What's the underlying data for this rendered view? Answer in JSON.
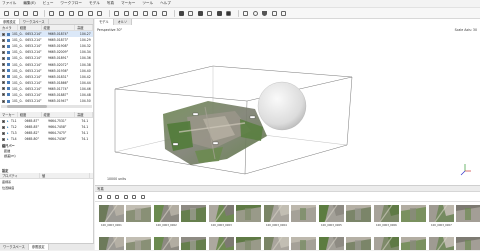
{
  "menu": [
    "ファイル",
    "編集(E)",
    "ビュー",
    "ワークフロー",
    "モデル",
    "写真",
    "マーカー",
    "ツール",
    "ヘルプ"
  ],
  "toolbar_icons": [
    "open-icon",
    "save-icon",
    "undo-icon",
    "redo-icon",
    "select-icon",
    "rect-select-icon",
    "circle-select-icon",
    "move-icon",
    "rotate-icon",
    "resize-icon",
    "ruler-icon",
    "cut-icon",
    "zoom-icon",
    "crop-icon",
    "points-icon",
    "reset-icon",
    "dense-cloud-icon",
    "mesh-icon",
    "solid-icon",
    "texture-icon",
    "tiled-icon",
    "camera-icon",
    "grid-icon",
    "globe-icon",
    "shield-icon",
    "eye-icon",
    "filter-icon"
  ],
  "left_panel": {
    "tabs": [
      "参照設定",
      "ワークスペース"
    ],
    "camera_header": [
      "カメラ",
      "経度",
      "緯度",
      "高度"
    ],
    "cameras": [
      {
        "name": "101_0...",
        "lon": "0653.214°",
        "lat": "9665.01874°",
        "alt": "104.27"
      },
      {
        "name": "101_0...",
        "lon": "0653.214°",
        "lat": "9665.01873°",
        "alt": "104.29"
      },
      {
        "name": "101_0...",
        "lon": "0653.214°",
        "lat": "9665.01908°",
        "alt": "104.32"
      },
      {
        "name": "101_0...",
        "lon": "0653.214°",
        "lat": "9665.02009°",
        "alt": "104.34"
      },
      {
        "name": "101_0...",
        "lon": "0653.214°",
        "lat": "9665.01891°",
        "alt": "104.36"
      },
      {
        "name": "101_0...",
        "lon": "0653.214°",
        "lat": "9665.02072°",
        "alt": "104.38"
      },
      {
        "name": "101_0...",
        "lon": "0653.214°",
        "lat": "9665.01936°",
        "alt": "104.40"
      },
      {
        "name": "101_0...",
        "lon": "0653.214°",
        "lat": "9665.01831°",
        "alt": "104.42"
      },
      {
        "name": "101_0...",
        "lon": "0653.214°",
        "lat": "9665.01866°",
        "alt": "104.44"
      },
      {
        "name": "101_0...",
        "lon": "0653.214°",
        "lat": "9665.01774°",
        "alt": "104.46"
      },
      {
        "name": "101_0...",
        "lon": "0653.214°",
        "lat": "9665.01887°",
        "alt": "104.48"
      },
      {
        "name": "101_0...",
        "lon": "0653.214°",
        "lat": "9665.01947°",
        "alt": "104.50"
      }
    ],
    "marker_header": [
      "マーカー",
      "経度",
      "緯度",
      "高度"
    ],
    "markers": [
      {
        "name": "TL1",
        "lon": "0665.87°",
        "lat": "9664.7531°",
        "alt": "74.1"
      },
      {
        "name": "TL2",
        "lon": "0665.85°",
        "lat": "9664.7458°",
        "alt": "74.1"
      },
      {
        "name": "TL3",
        "lon": "0665.82°",
        "lat": "9664.7475°",
        "alt": "74.1"
      },
      {
        "name": "TL4",
        "lon": "0665.80°",
        "lat": "9664.7436°",
        "alt": "74.1"
      }
    ],
    "section2_title": "縮尺バー",
    "section2_items": [
      "距離",
      "誤差(m)"
    ],
    "section3_title": "設定",
    "settings_header": [
      "プロパティ",
      "値"
    ],
    "settings_rows": [
      {
        "k": "座標系",
        "v": ""
      },
      {
        "k": "位置精度",
        "v": ""
      }
    ],
    "bottom_tabs": [
      "ワークスペース",
      "参照設定"
    ]
  },
  "viewport": {
    "tabs": [
      "モデル",
      "オルソ"
    ],
    "projection": "Perspective 30°",
    "info": "Scale Axis: 30",
    "scale_label": "10000 units"
  },
  "photos": {
    "tab": "写真",
    "labels": [
      "100_0003_0001",
      "100_0003_0002",
      "100_0003_0003",
      "100_0003_0004",
      "100_0003_0005",
      "100_0003_0006",
      "100_0003_0007",
      "100_0003_0008",
      "100_0003_0009",
      "100_0003_0010",
      "100_0003_0011",
      "100_0003_0012",
      "100_0003_0013",
      "100_0003_0014"
    ]
  }
}
